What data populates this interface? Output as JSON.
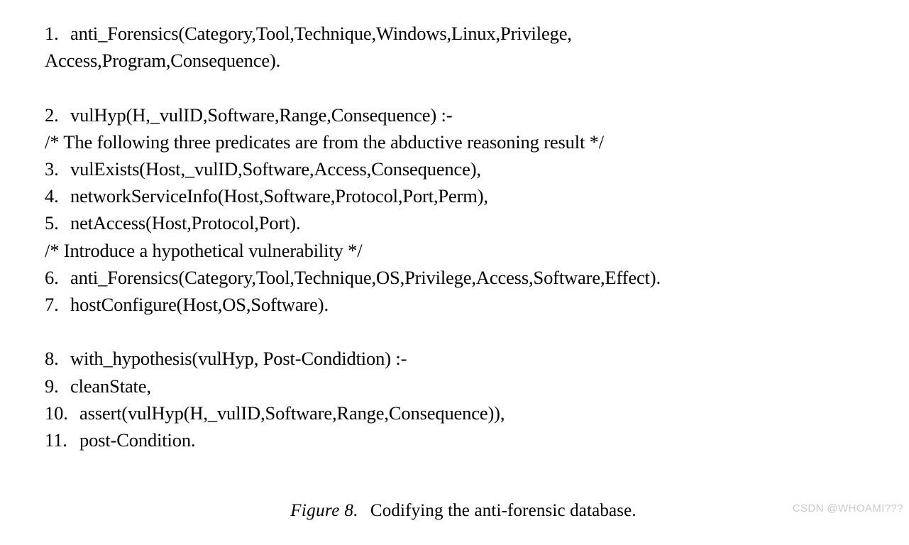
{
  "document": {
    "kind": "figure",
    "background_color": "#ffffff",
    "text_color": "#000000"
  },
  "listing": {
    "lines": [
      {
        "number": "1.",
        "text": "anti_Forensics(Category,Tool,Technique,Windows,Linux,Privilege,",
        "type": "clause"
      },
      {
        "number": "",
        "text": "Access,Program,Consequence).",
        "type": "continuation"
      },
      {
        "number": "",
        "text": "",
        "type": "blank"
      },
      {
        "number": "2.",
        "text": "vulHyp(H,_vulID,Software,Range,Consequence) :-",
        "type": "clause"
      },
      {
        "number": "",
        "text": "/* The following three predicates are from the abductive reasoning result */",
        "type": "comment"
      },
      {
        "number": "3.",
        "text": "vulExists(Host,_vulID,Software,Access,Consequence),",
        "type": "clause"
      },
      {
        "number": "4.",
        "text": "networkServiceInfo(Host,Software,Protocol,Port,Perm),",
        "type": "clause"
      },
      {
        "number": "5.",
        "text": "netAccess(Host,Protocol,Port).",
        "type": "clause"
      },
      {
        "number": "",
        "text": "/* Introduce a hypothetical vulnerability */",
        "type": "comment"
      },
      {
        "number": "6.",
        "text": "anti_Forensics(Category,Tool,Technique,OS,Privilege,Access,Software,Effect).",
        "type": "clause"
      },
      {
        "number": "7.",
        "text": "hostConfigure(Host,OS,Software).",
        "type": "clause"
      },
      {
        "number": "",
        "text": "",
        "type": "blank"
      },
      {
        "number": "8.",
        "text": "with_hypothesis(vulHyp, Post-Condidtion) :-",
        "type": "clause"
      },
      {
        "number": "9.",
        "text": "cleanState,",
        "type": "clause"
      },
      {
        "number": "10.",
        "text": "assert(vulHyp(H,_vulID,Software,Range,Consequence)),",
        "type": "clause"
      },
      {
        "number": "11.",
        "text": "post-Condition.",
        "type": "clause"
      }
    ]
  },
  "caption": {
    "label": "Figure 8.",
    "text": "Codifying the anti-forensic database."
  },
  "watermark": {
    "text": "CSDN @WHOAMI???",
    "color": "#c9c9c9"
  }
}
